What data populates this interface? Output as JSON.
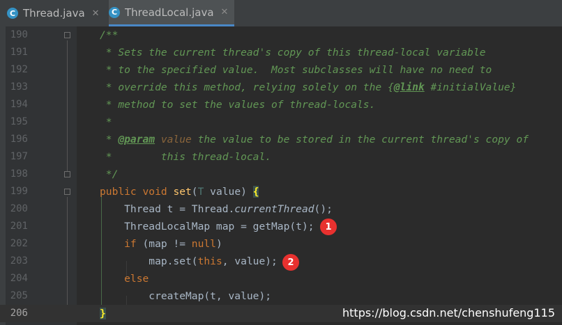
{
  "tabs": [
    {
      "label": "Thread.java",
      "icon": "java-class-icon",
      "icon_char": "C"
    },
    {
      "label": "ThreadLocal.java",
      "icon": "java-class-icon",
      "icon_char": "C",
      "active": true
    }
  ],
  "close_glyph": "✕",
  "lines": [
    {
      "n": "190"
    },
    {
      "n": "191"
    },
    {
      "n": "192"
    },
    {
      "n": "193"
    },
    {
      "n": "194"
    },
    {
      "n": "195"
    },
    {
      "n": "196"
    },
    {
      "n": "197"
    },
    {
      "n": "198"
    },
    {
      "n": "199"
    },
    {
      "n": "200"
    },
    {
      "n": "201"
    },
    {
      "n": "202"
    },
    {
      "n": "203"
    },
    {
      "n": "204"
    },
    {
      "n": "205"
    },
    {
      "n": "206"
    }
  ],
  "code": {
    "l190": "/**",
    "l191": " * Sets the current thread's copy of this thread-local variable",
    "l192": " * to the specified value.  Most subclasses will have no need to",
    "l193a": " * override this method, relying solely on the {",
    "l193tag": "@link",
    "l193b": " #initialValue}",
    "l194": " * method to set the values of thread-locals.",
    "l195": " *",
    "l196a": " * ",
    "l196tag": "@param",
    "l196p": " value",
    "l196b": " the value to be stored in the current thread's copy of",
    "l197": " *        this thread-local.",
    "l198": " */",
    "l199kw": "public void ",
    "l199fn": "set",
    "l199a": "(",
    "l199t": "T",
    "l199b": " value) ",
    "l199brace": "{",
    "l200a": "    Thread t = Thread.",
    "l200it": "currentThread",
    "l200b": "();",
    "l201": "    ThreadLocalMap map = getMap(t);",
    "l202kw": "    if",
    "l202a": " (map != ",
    "l202kw2": "null",
    "l202b": ")",
    "l203a": "        map.set(",
    "l203kw": "this",
    "l203b": ", value);",
    "l204kw": "    else",
    "l205a": "        createMap(t, value);",
    "l206brace": "}"
  },
  "annotations": [
    "1",
    "2"
  ],
  "watermark": "https://blog.csdn.net/chenshufeng115",
  "colors": {
    "background": "#2b2b2b",
    "gutter": "#313335",
    "comment": "#629755",
    "keyword": "#cc7832",
    "method": "#ffc66d",
    "annotation_badge": "#e8312f"
  }
}
